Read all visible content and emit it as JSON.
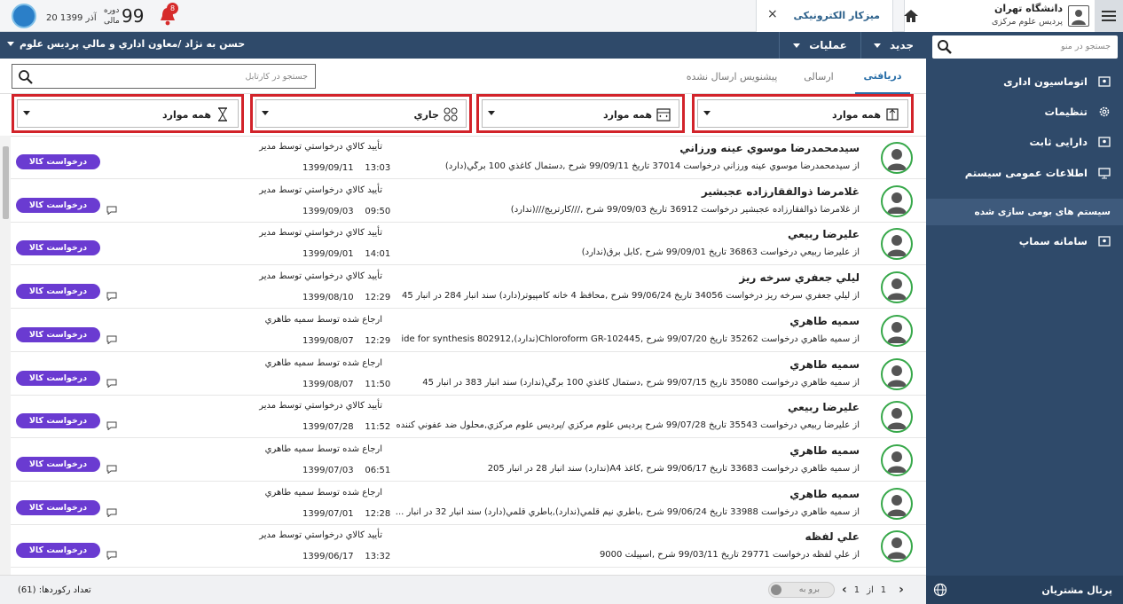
{
  "brand": {
    "university": "دانشگاه تهران",
    "campus": "پردیس علوم مرکزی"
  },
  "tab": {
    "label": "میزکار الکترونیکی",
    "close": "×"
  },
  "header": {
    "date": "20 آذر 1399",
    "period_label_1": "دوره",
    "period_label_2": "مالی",
    "year": "99",
    "notif_count": "8"
  },
  "navbar": {
    "user_path": "حسن به نژاد /معاون اداري و مالي پرديس علوم",
    "new_menu": "جدید",
    "ops_menu": "عملیات"
  },
  "sidebar": {
    "search_placeholder": "جستجو در منو",
    "items": [
      {
        "label": "اتوماسیون اداری",
        "icon": "window-icon"
      },
      {
        "label": "تنظیمات",
        "icon": "gear-icon"
      },
      {
        "label": "دارایی ثابت",
        "icon": "window-icon"
      },
      {
        "label": "اطلاعات عمومی سیستم",
        "icon": "monitor-icon"
      },
      {
        "label": "سیستم های بومی سازی شده",
        "icon": ""
      },
      {
        "label": "سامانه سماپ",
        "icon": "window-icon"
      }
    ],
    "portal": "پرتال مشتریان"
  },
  "main": {
    "tabs": [
      "دریافتی",
      "ارسالی",
      "پیشنویس ارسال نشده"
    ],
    "search_placeholder": "جستجو در کارتابل",
    "filters": [
      "همه موارد",
      "همه موارد",
      "جاري",
      "همه موارد"
    ],
    "pill_label": "درخواست كالا",
    "rows": [
      {
        "name": "سيدمحمدرضا موسوي عينه ورزاني",
        "desc": "از سيدمحمدرضا موسوي عينه ورزاني درخواست 37014 تاريخ 99/09/11 شرح ,دستمال کاغذي 100 برگي(دارد)",
        "status": "تأييد كالاي درخواستي توسط مدير",
        "date": "1399/09/11",
        "time": "13:03",
        "comment": false
      },
      {
        "name": "غلامرضا ذوالفقارزاده عجبشير",
        "desc": "از غلامرضا ذوالفقارزاده عجبشير درخواست 36912 تاريخ 99/09/03 شرح ,///کارتريج///(ندارد)",
        "status": "تأييد كالاي درخواستي توسط مدير",
        "date": "1399/09/03",
        "time": "09:50",
        "comment": true
      },
      {
        "name": "عليرضا ربيعي",
        "desc": "از عليرضا ربيعي درخواست 36863 تاريخ 99/09/01 شرح ,کابل برق(ندارد)",
        "status": "تأييد كالاي درخواستي توسط مدير",
        "date": "1399/09/01",
        "time": "14:01",
        "comment": false
      },
      {
        "name": "ليلي جعفري سرخه ريز",
        "desc": "از ليلي جعفري سرخه ريز درخواست 34056 تاريخ 99/06/24 شرح ,محافظ 4 خانه کامپيوتر(دارد) سند انبار 284 در انبار 45",
        "status": "تأييد كالاي درخواستي توسط مدير",
        "date": "1399/08/10",
        "time": "12:29",
        "comment": true
      },
      {
        "name": "سميه طاهري",
        "desc": "از سميه طاهري درخواست 35262 تاريخ 99/07/20 شرح ,Chloroform GR-102445(ندارد),ide for synthesis 802912",
        "status": "ارجاع شده توسط سميه طاهري",
        "date": "1399/08/07",
        "time": "12:29",
        "comment": true
      },
      {
        "name": "سميه طاهري",
        "desc": "از سميه طاهري درخواست 35080 تاريخ 99/07/15 شرح ,دستمال کاغذي 100 برگي(ندارد) سند انبار 383 در انبار 45",
        "status": "ارجاع شده توسط سميه طاهري",
        "date": "1399/08/07",
        "time": "11:50",
        "comment": true
      },
      {
        "name": "عليرضا ربيعي",
        "desc": "از عليرضا ربيعي درخواست 35543 تاريخ 99/07/28 شرح پرديس علوم مرکزي /پرديس علوم مرکزي,محلول ضد عفوني کننده",
        "status": "تأييد كالاي درخواستي توسط مدير",
        "date": "1399/07/28",
        "time": "11:52",
        "comment": true
      },
      {
        "name": "سميه طاهري",
        "desc": "از سميه طاهري درخواست 33683 تاريخ 99/06/17 شرح ,کاغذ A4(ندارد) سند انبار 28 در انبار 205",
        "status": "ارجاع شده توسط سميه طاهري",
        "date": "1399/07/03",
        "time": "06:51",
        "comment": true
      },
      {
        "name": "سميه طاهري",
        "desc": "از سميه طاهري درخواست 33988 تاريخ 99/06/24 شرح ,باطري نيم قلمي(ندارد),باطري قلمي(دارد) سند انبار 32 در انبار ...",
        "status": "ارجاع شده توسط سميه طاهري",
        "date": "1399/07/01",
        "time": "12:28",
        "comment": true
      },
      {
        "name": "علي لفظه",
        "desc": "از علي لفظه درخواست 29771 تاريخ 99/03/11 شرح ,اسپيلت 9000",
        "status": "تأييد كالاي درخواستي توسط مدير",
        "date": "1399/06/17",
        "time": "13:32",
        "comment": true
      }
    ]
  },
  "footer": {
    "records": "تعداد رکوردها: (61)",
    "goto": "برو به",
    "page": "1",
    "of": "از",
    "total": "1"
  }
}
